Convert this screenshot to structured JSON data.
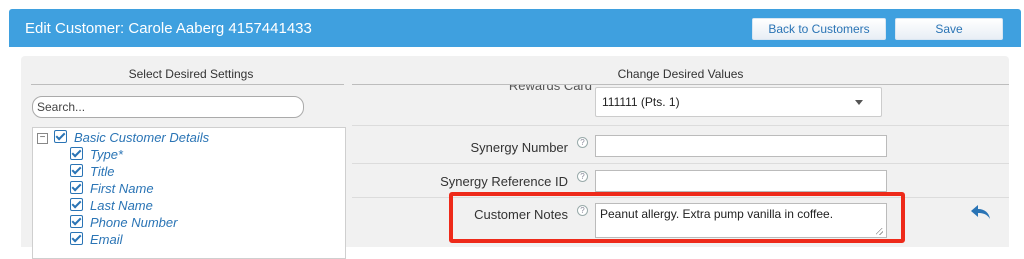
{
  "header": {
    "title": "Edit Customer: Carole Aaberg 4157441433",
    "back_label": "Back to Customers",
    "save_label": "Save",
    "bar_color": "#3fa0df"
  },
  "left_panel": {
    "heading": "Select Desired Settings",
    "search": {
      "placeholder": "Search...",
      "value": ""
    },
    "tree": {
      "group_label": "Basic Customer Details",
      "group_expander": "−",
      "items": [
        "Type*",
        "Title",
        "First Name",
        "Last Name",
        "Phone Number",
        "Email"
      ]
    }
  },
  "right_panel": {
    "heading": "Change Desired Values",
    "partial_label": "Rewards Card",
    "rewards_select_value": "111111 (Pts. 1)",
    "fields": [
      {
        "label": "Synergy Number",
        "value": ""
      },
      {
        "label": "Synergy Reference ID",
        "value": ""
      },
      {
        "label": "Customer Notes",
        "value": "Peanut allergy. Extra pump vanilla in coffee."
      }
    ],
    "help_glyph": "?",
    "highlight_color": "#ee2a1a",
    "undo_icon": "undo-arrow-icon"
  }
}
